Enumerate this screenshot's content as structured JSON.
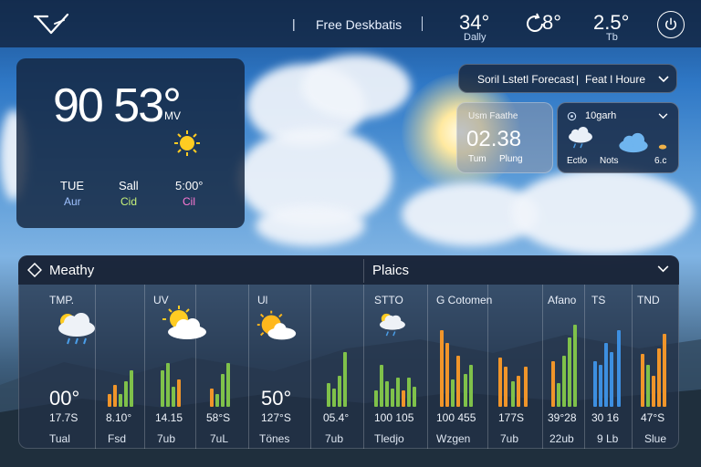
{
  "topbar": {
    "separator": "|",
    "title": "Free Deskbatis",
    "temp_1": "34°",
    "temp_1_sub": "Dally",
    "temp_2": "8°",
    "temp_3": "2.5°",
    "temp_3_sub": "Tb"
  },
  "current": {
    "temperature": "90 53°",
    "unit": "MV",
    "items": [
      {
        "top": "TUE",
        "bottom": "Aur"
      },
      {
        "top": "Sall",
        "bottom": "Cid"
      },
      {
        "top": "5:00°",
        "bottom": "Cil"
      }
    ]
  },
  "forecast_dropdown": {
    "label": "Soril Lstetl Forecast",
    "sep": "|",
    "label2": "Feat l Houre"
  },
  "sun_panel": {
    "title": "Usm Faathe",
    "time": "02.38",
    "left": "Tum",
    "right": "Plung"
  },
  "cloud_panel": {
    "title": "10garh",
    "left": "Ectlo",
    "mid": "Nots",
    "right": "6.c"
  },
  "bottom_panel": {
    "left_title": "Meathy",
    "right_title": "Plaics",
    "columns": [
      {
        "header": "TMP.",
        "big": "00°",
        "value": "17.7S",
        "label": "Tual"
      },
      {
        "header": "",
        "big": "",
        "value": "8.10°",
        "label": "Fsd"
      },
      {
        "header": "UV",
        "big": "",
        "value": "14.15",
        "label": "7ub"
      },
      {
        "header": "",
        "big": "",
        "value": "58°S",
        "label": "7uL"
      },
      {
        "header": "Ul",
        "big": "50°",
        "value": "127°S",
        "label": "Tönes"
      },
      {
        "header": "",
        "big": "",
        "value": "05.4°",
        "label": "7ub"
      },
      {
        "header": "STTO",
        "big": "",
        "value": "100 105",
        "label": "Tledjo"
      },
      {
        "header": "G  Cotomen",
        "big": "",
        "value": "100 455",
        "label": "Wzgen"
      },
      {
        "header": "",
        "big": "",
        "value": "177S",
        "label": "7ub"
      },
      {
        "header": "Afano",
        "big": "",
        "value": "39°28",
        "label": "22ub"
      },
      {
        "header": "TS",
        "big": "",
        "value": "30 16",
        "label": "9 Lb"
      },
      {
        "header": "TND",
        "big": "",
        "value": "47°S",
        "label": "Slue"
      }
    ]
  },
  "colors": {
    "orange": "#f0952a",
    "green": "#7fc14a",
    "blue": "#3d8fe0",
    "yellow": "#ffcc22",
    "lime": "#c7f27a",
    "pink": "#ff7ad6"
  }
}
